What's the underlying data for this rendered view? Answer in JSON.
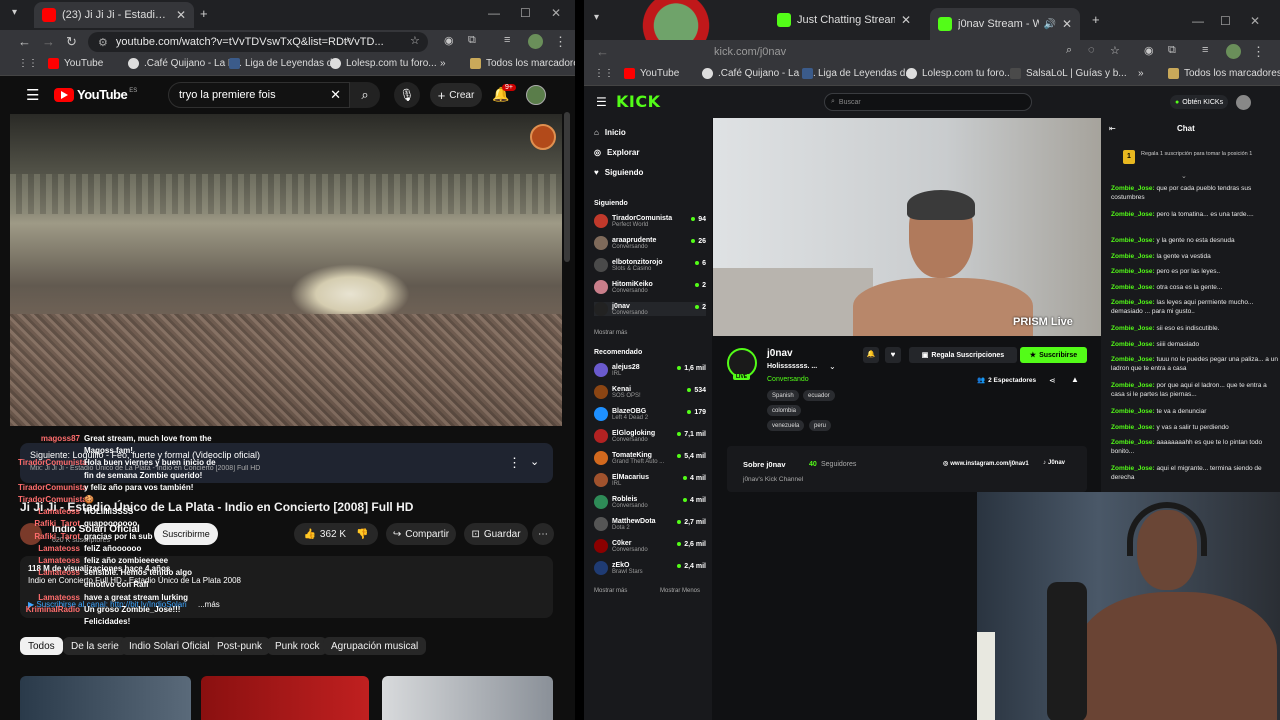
{
  "left_browser": {
    "tab_title": "(23) Ji Ji Ji - Estadio Único de La...",
    "url": "youtube.com/watch?v=tVvTDVswTxQ&list=RDtVvTD...",
    "bookmarks": [
      "YouTube",
      ".Café Quijano - La L...",
      "Liga de Leyendas d...",
      "Lolesp.com tu foro...",
      "»"
    ],
    "all_bookmarks": "Todos los marcadores",
    "yt": {
      "logo": "YouTube",
      "logo_region": "ES",
      "search_value": "tryo la premiere fois",
      "create_label": "Crear",
      "notif_count": "9+",
      "up_next_label": "Siguiente: Loquillo - Feo, fuerte y formal (Videoclip oficial)",
      "up_next_sub": "Mix: Ji Ji Ji - Estadio Único de La Plata - Indio en Concierto [2008] Full HD",
      "video_title": "Ji Ji Ji - Estadio Único de La Plata - Indio en Concierto [2008] Full HD",
      "channel": "Indio Solari Oficial",
      "subs": "620 K suscriptores",
      "subscribe": "Suscribirme",
      "likes": "362 K",
      "share": "Compartir",
      "save": "Guardar",
      "desc_meta": "118 M de visualizaciones  hace 4 años",
      "desc_line": "Indio en Concierto Full HD - Estadio Único de La Plata 2008",
      "desc_link": "▶ Suscribirse al canal: http://bit.ly/IndioSolari",
      "more": "...más",
      "chips": [
        "Todos",
        "De la serie",
        "Indio Solari Oficial",
        "Post-punk",
        "Punk rock",
        "Agrupación musical"
      ]
    },
    "overlay_chat": [
      {
        "name": "magoss87",
        "text": "Great stream, much love from the"
      },
      {
        "name": "",
        "text": "Magoss fam!"
      },
      {
        "name": "TiradorComunista",
        "text": "Hola buen viernes y buen inicio de"
      },
      {
        "name": "",
        "text": "fin de semana Zombie querido!"
      },
      {
        "name": "TiradorComunista",
        "text": "y feliz año para vos también!"
      },
      {
        "name": "TiradorComunista",
        "text": "🍪"
      },
      {
        "name": "Lamateoss",
        "text": "HOLIIIIISSSS"
      },
      {
        "name": "Rafiki_Tarot",
        "text": "guapooooooo"
      },
      {
        "name": "Rafiki_Tarot",
        "text": "gracias por la sub"
      },
      {
        "name": "Lamateoss",
        "text": "feliZ añoooooo"
      },
      {
        "name": "Lamateoss",
        "text": "feliz año zombieeeeee"
      },
      {
        "name": "Lamateoss",
        "text": "sensible. Hemos tenido algo"
      },
      {
        "name": "",
        "text": "emotivo con Rafi"
      },
      {
        "name": "Lamateoss",
        "text": "have a great stream lurking"
      },
      {
        "name": "KriminalRadio",
        "text": "Un groso Zombie_Jose!!!"
      },
      {
        "name": "",
        "text": "Felicidades!"
      }
    ]
  },
  "right_browser": {
    "tabs": [
      "Just Chatting Streaming - Live S...",
      "j0nav Stream - Watch Live o..."
    ],
    "url": "kick.com/j0nav",
    "bookmarks": [
      "YouTube",
      ".Café Quijano - La L...",
      "Liga de Leyendas d...",
      "Lolesp.com tu foro...",
      "SalsaLoL | Guías y b...",
      "»"
    ],
    "all_bookmarks": "Todos los marcadores",
    "kick": {
      "logo": "KICK",
      "search_placeholder": "Buscar",
      "get_kicks": "Obtén KICKs",
      "nav": [
        "Inicio",
        "Explorar",
        "Siguiendo"
      ],
      "following_title": "Siguiendo",
      "following": [
        {
          "name": "TiradorComunista",
          "sub": "Perfect World",
          "count": "94",
          "color": "#c0392b"
        },
        {
          "name": "araaprudente",
          "sub": "Conversando",
          "count": "26",
          "color": "#7f6a5a"
        },
        {
          "name": "elbotonzitorojo",
          "sub": "Slots & Casino",
          "count": "6",
          "color": "#4a4a4a"
        },
        {
          "name": "HitomiKeiko",
          "sub": "Conversando",
          "count": "2",
          "color": "#c97e8a"
        },
        {
          "name": "j0nav",
          "sub": "Conversando",
          "count": "2",
          "color": "#222"
        }
      ],
      "show_more": "Mostrar más",
      "recommended_title": "Recomendado",
      "recommended": [
        {
          "name": "alejus28",
          "sub": "IRL",
          "count": "1,6 mil",
          "color": "#6a5acd"
        },
        {
          "name": "Kenai",
          "sub": "SOS OPS!",
          "count": "534",
          "color": "#8b4513"
        },
        {
          "name": "BlazeOBG",
          "sub": "Left 4 Dead 2",
          "count": "179",
          "color": "#1e90ff"
        },
        {
          "name": "ElGlogloking",
          "sub": "Conversando",
          "count": "7,1 mil",
          "color": "#b22222"
        },
        {
          "name": "TomateKing",
          "sub": "Grand Theft Auto ...",
          "count": "5,4 mil",
          "color": "#d2691e"
        },
        {
          "name": "ElMacarius",
          "sub": "IRL",
          "count": "4 mil",
          "color": "#a0522d"
        },
        {
          "name": "Robleis",
          "sub": "Conversando",
          "count": "4 mil",
          "color": "#2e8b57"
        },
        {
          "name": "MatthewDota",
          "sub": "Dota 2",
          "count": "2,7 mil",
          "color": "#555"
        },
        {
          "name": "C0ker",
          "sub": "Conversando",
          "count": "2,6 mil",
          "color": "#8b0000"
        },
        {
          "name": "zEkO",
          "sub": "Brawl Stars",
          "count": "2,4 mil",
          "color": "#1f3b73"
        }
      ],
      "show_more_2": "Mostrar más",
      "show_less": "Mostrar Menos",
      "watermark": "PRISM Live",
      "streamer": "j0nav",
      "live_badge": "LIVE",
      "stream_title": "Holisssssss. ...",
      "category": "Conversando",
      "tags": [
        "Spanish",
        "ecuador",
        "colombia",
        "venezuela",
        "peru"
      ],
      "gift_subs": "Regala Suscripciones",
      "subscribe": "Suscribirse",
      "viewers": "2 Espectadores",
      "about_title": "Sobre j0nav",
      "followers_count": "40",
      "followers_label": "Seguidores",
      "instagram": "www.instagram.com/j0nav1",
      "tiktok": "J0nav",
      "channel_desc": "j0nav's Kick Channel",
      "chat_title": "Chat",
      "gift_prompt": "Regala 1 suscripción para tomar la posición 1",
      "gift_rank": "1",
      "chat": [
        {
          "user": "Zombie_Jose:",
          "text": "que por cada pueblo tendras sus costumbres"
        },
        {
          "user": "Zombie_Jose:",
          "text": "pero la tomatina... es una tarde...."
        },
        {
          "user": "Zombie_Jose:",
          "text": "y la gente no esta desnuda"
        },
        {
          "user": "Zombie_Jose:",
          "text": "la gente va vestida"
        },
        {
          "user": "Zombie_Jose:",
          "text": "pero es por las leyes.."
        },
        {
          "user": "Zombie_Jose:",
          "text": "otra cosa es la gente..."
        },
        {
          "user": "Zombie_Jose:",
          "text": "las leyes aqui permiente mucho... demasiado ... para mi gusto.."
        },
        {
          "user": "Zombie_Jose:",
          "text": "sii eso es indiscutible."
        },
        {
          "user": "Zombie_Jose:",
          "text": "siiii demasiado"
        },
        {
          "user": "Zombie_Jose:",
          "text": "tuuu no le puedes pegar una paliza... a un ladron que te entra a casa"
        },
        {
          "user": "Zombie_Jose:",
          "text": "por que aqui el ladron... que te entra a casa si le partes las piernas..."
        },
        {
          "user": "Zombie_Jose:",
          "text": "te va a denunciar"
        },
        {
          "user": "Zombie_Jose:",
          "text": "y vas a salir tu perdiendo"
        },
        {
          "user": "Zombie_Jose:",
          "text": "aaaaaaaahh es que te lo pintan todo bonito..."
        },
        {
          "user": "Zombie_Jose:",
          "text": "aqui el migrante... termina siendo de derecha"
        }
      ]
    }
  },
  "colors": {
    "kick_green": "#53fc18",
    "yt_red": "#ff0000",
    "bg_dark": "#0f0f0f"
  }
}
